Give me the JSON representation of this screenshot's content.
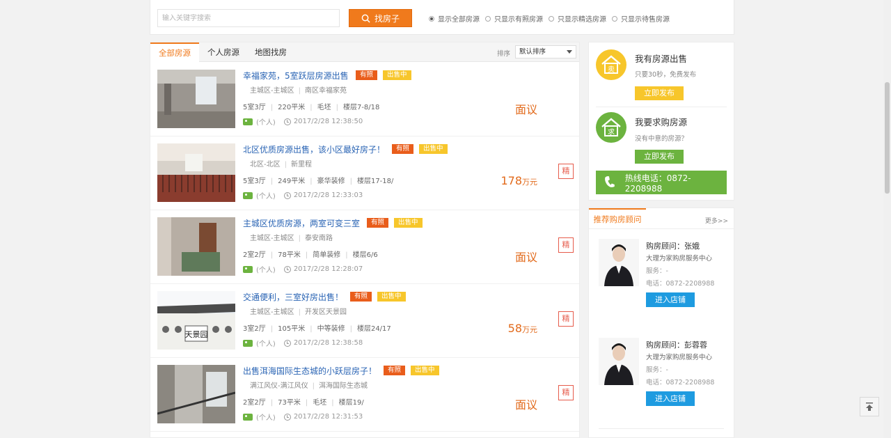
{
  "search": {
    "placeholder": "输入关键字搜索",
    "button_label": "找房子",
    "filters": [
      {
        "label": "显示全部房源",
        "checked": true
      },
      {
        "label": "只显示有照房源",
        "checked": false
      },
      {
        "label": "只显示精选房源",
        "checked": false
      },
      {
        "label": "只显示待售房源",
        "checked": false
      }
    ]
  },
  "tabs": [
    "全部房源",
    "个人房源",
    "地图找房"
  ],
  "sort": {
    "label": "排序",
    "selected": "默认排序"
  },
  "listings": [
    {
      "title": "幸福家苑，5室跃层房源出售",
      "badges": [
        "有照",
        "出售中"
      ],
      "district": "主城区-主城区",
      "community": "南区幸福家苑",
      "layout": "5室3厅",
      "area": "220平米",
      "decoration": "毛坯",
      "floor": "楼层7-8/18",
      "poster": "(个人)",
      "time": "2017/2/28 12:38:50",
      "price": "面议",
      "price_unit": "",
      "featured": false
    },
    {
      "title": "北区优质房源出售，该小区最好房子！",
      "badges": [
        "有照",
        "出售中"
      ],
      "district": "北区-北区",
      "community": "新里程",
      "layout": "5室3厅",
      "area": "249平米",
      "decoration": "豪华装修",
      "floor": "楼层17-18/",
      "poster": "(个人)",
      "time": "2017/2/28 12:33:03",
      "price": "178",
      "price_unit": "万元",
      "featured": true
    },
    {
      "title": "主城区优质房源，两室可变三室",
      "badges": [
        "有照",
        "出售中"
      ],
      "district": "主城区-主城区",
      "community": "泰安南路",
      "layout": "2室2厅",
      "area": "78平米",
      "decoration": "简单装修",
      "floor": "楼层6/6",
      "poster": "(个人)",
      "time": "2017/2/28 12:28:07",
      "price": "面议",
      "price_unit": "",
      "featured": true
    },
    {
      "title": "交通便利，三室好房出售！",
      "badges": [
        "有照",
        "出售中"
      ],
      "district": "主城区-主城区",
      "community": "开发区天景园",
      "layout": "3室2厅",
      "area": "105平米",
      "decoration": "中等装修",
      "floor": "楼层24/17",
      "poster": "(个人)",
      "time": "2017/2/28 12:38:58",
      "price": "58",
      "price_unit": "万元",
      "featured": true
    },
    {
      "title": "出售洱海国际生态城的小跃层房子！",
      "badges": [
        "有照",
        "出售中"
      ],
      "district": "满江风仪-满江风仪",
      "community": "洱海国际生态城",
      "layout": "2室2厅",
      "area": "73平米",
      "decoration": "毛坯",
      "floor": "楼层19/",
      "poster": "(个人)",
      "time": "2017/2/28 12:31:53",
      "price": "面议",
      "price_unit": "",
      "featured": true
    }
  ],
  "featured_label": "精",
  "sell_box": {
    "title": "我有房源出售",
    "subtitle": "只要30秒，免费发布",
    "button": "立即发布",
    "icon_char": "卖",
    "color": "#f7c62b"
  },
  "buy_box": {
    "title": "我要求购房源",
    "subtitle": "没有中意的房源？",
    "button": "立即发布",
    "icon_char": "求",
    "color": "#6cb33f"
  },
  "hotline": "热线电话：0872-2208988",
  "advisors": {
    "title": "推荐购房顾问",
    "more": "更多>>",
    "items": [
      {
        "name": "购房顾问：张娥",
        "org": "大理为家购房服务中心",
        "service": "服务：-",
        "phone": "电话：0872-2208988",
        "button": "进入店铺"
      },
      {
        "name": "购房顾问：彭蓉蓉",
        "org": "大理为家购房服务中心",
        "service": "服务：-",
        "phone": "电话：0872-2208988",
        "button": "进入店铺"
      }
    ]
  }
}
